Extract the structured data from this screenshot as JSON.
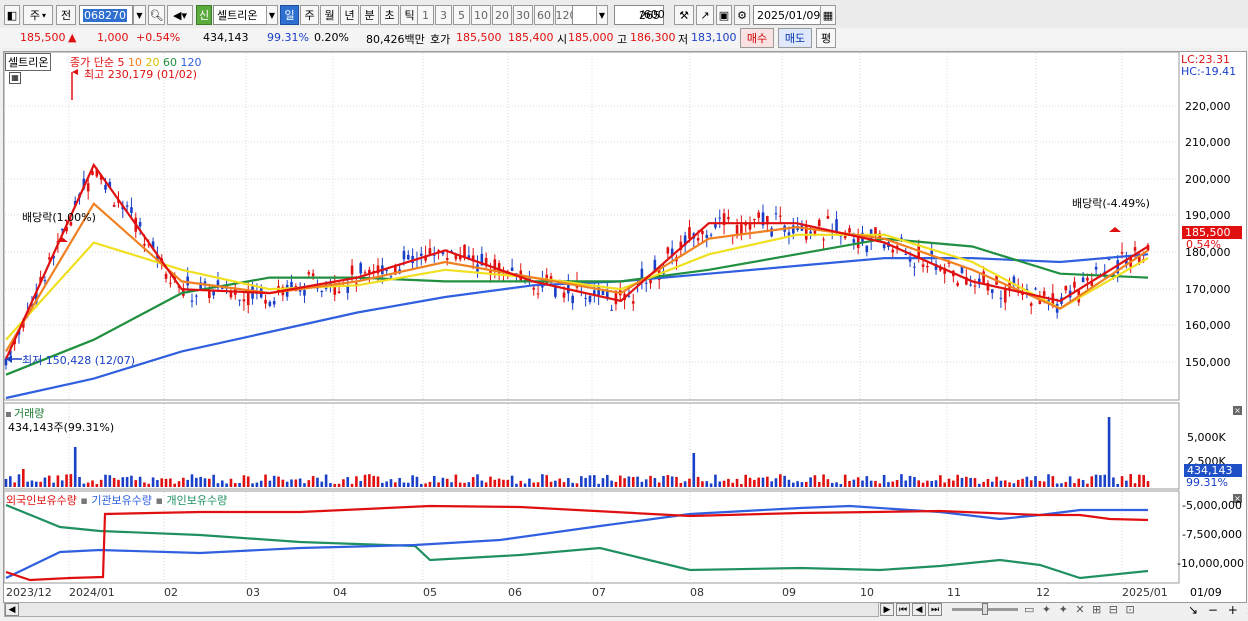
{
  "toolbar": {
    "market_btn": "주",
    "market_arrow": "▾",
    "prev_label": "전",
    "code": "068270",
    "stock_name": "셀트리온",
    "credit_badge": "신",
    "periods": [
      "일",
      "주",
      "월",
      "년",
      "분",
      "초",
      "틱"
    ],
    "selected_period": "일",
    "intervals": [
      "1",
      "3",
      "5",
      "10",
      "20",
      "30",
      "60",
      "120"
    ],
    "count_value": "265",
    "count_total": "/600",
    "date_value": "2025/01/09"
  },
  "quote": {
    "price": "185,500",
    "change_arrow": "▲",
    "change": "1,000",
    "change_pct": "+0.54%",
    "volume": "434,143",
    "vol_ratio": "99.31%",
    "turnover_pct": "0.20%",
    "amount": "80,426백만",
    "hoga_label": "호가",
    "ask": "185,500",
    "bid": "185,400",
    "open_label": "시",
    "open": "185,000",
    "high_label": "고",
    "high": "186,300",
    "low_label": "저",
    "low": "183,100",
    "buy_btn": "매수",
    "sell_btn": "매도",
    "eval_btn": "평"
  },
  "price_panel": {
    "name_tag": "셀트리온",
    "ma_title": "종가 단순",
    "ma_periods": [
      "5",
      "10",
      "20",
      "60",
      "120"
    ],
    "high_note": "최고 230,179 (01/02)",
    "low_note": "최저 150,428 (12/07)",
    "div_note_1": "배당락(1.00%)",
    "div_note_2": "배당락(-4.49%)",
    "lc": "LC:23.31",
    "hc": "HC:-19.41",
    "last_price_tag": "185,500",
    "last_pct_tag": "0.54%",
    "y_labels": [
      "220,000",
      "210,000",
      "200,000",
      "190,000",
      "180,000",
      "170,000",
      "160,000",
      "150,000"
    ]
  },
  "volume_panel": {
    "title": "거래량",
    "current": "434,143주(99.31%)",
    "y_labels": [
      "5,000K",
      "2,500K"
    ],
    "last_tag": "434,143",
    "last_pct": "99.31%"
  },
  "holding_panel": {
    "legend": [
      "외국인보유수량",
      "기관보유수량",
      "개인보유수량"
    ],
    "y_labels": [
      "-5,000,000",
      "-7,500,000",
      "-10,000,000"
    ]
  },
  "x_labels": [
    "2023/12",
    "2024/01",
    "02",
    "03",
    "04",
    "05",
    "06",
    "07",
    "08",
    "09",
    "10",
    "11",
    "12",
    "2025/01"
  ],
  "x_right_label": "01/09",
  "colors": {
    "up": "#e01010",
    "down": "#1a40c8",
    "ma5": "#e01010",
    "ma10": "#f08020",
    "ma20": "#f0e020",
    "ma60": "#209040",
    "ma120": "#3060e0",
    "foreign": "#e01010",
    "inst": "#3060e0",
    "indiv": "#209060"
  },
  "chart_data": {
    "type": "line",
    "x": [
      "2023/12",
      "2024/01",
      "02",
      "03",
      "04",
      "05",
      "06",
      "07",
      "08",
      "09",
      "10",
      "11",
      "12",
      "2025/01"
    ],
    "series": [
      {
        "name": "5",
        "values": [
          155000,
          205000,
          173000,
          172000,
          176000,
          183000,
          175000,
          170000,
          190000,
          190000,
          185000,
          175000,
          170000,
          184000
        ]
      },
      {
        "name": "10",
        "values": [
          157000,
          195000,
          175000,
          172000,
          175000,
          180000,
          176000,
          172000,
          186000,
          189000,
          186000,
          178000,
          168000,
          183000
        ]
      },
      {
        "name": "20",
        "values": [
          160000,
          185000,
          178000,
          173000,
          174000,
          178000,
          176000,
          173000,
          182000,
          187000,
          187000,
          180000,
          168000,
          181000
        ]
      },
      {
        "name": "60",
        "values": [
          151000,
          160000,
          172000,
          176000,
          176000,
          175000,
          175000,
          175000,
          178000,
          182000,
          186000,
          184000,
          177000,
          176000
        ]
      },
      {
        "name": "120",
        "values": [
          145000,
          150000,
          157000,
          162000,
          167000,
          171000,
          174000,
          175000,
          177000,
          179000,
          181000,
          181000,
          180000,
          182000
        ]
      }
    ],
    "ylim": [
      145000,
      232000
    ]
  }
}
